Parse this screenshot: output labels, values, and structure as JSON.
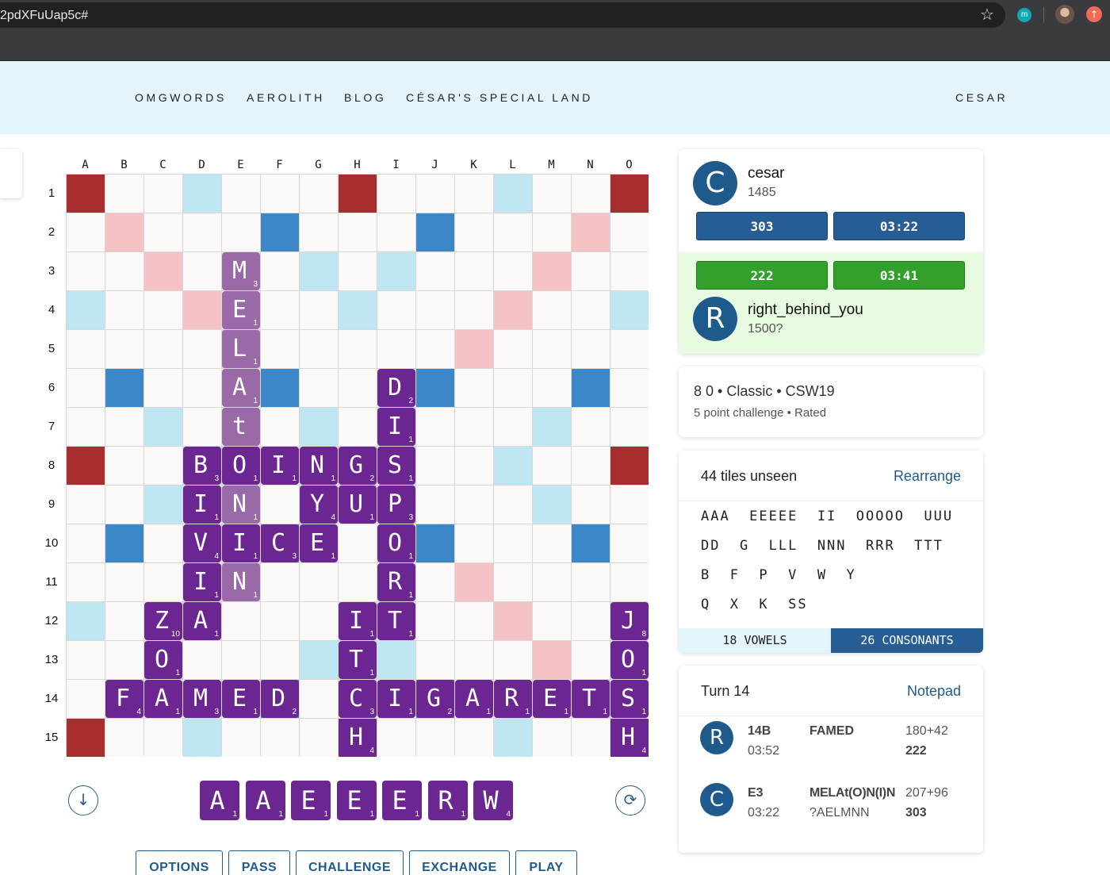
{
  "browser": {
    "url": "2pdXFuUap5c#",
    "icons": [
      "star-icon",
      "extension-m-icon",
      "profile-avatar",
      "update-arrow-icon"
    ],
    "ext_m_label": "m"
  },
  "nav": {
    "items": [
      "OMGWORDS",
      "AEROLITH",
      "BLOG",
      "CÉSAR'S SPECIAL LAND"
    ],
    "user": "CESAR"
  },
  "board": {
    "columns": [
      "A",
      "B",
      "C",
      "D",
      "E",
      "F",
      "G",
      "H",
      "I",
      "J",
      "K",
      "L",
      "M",
      "N",
      "O"
    ],
    "rows": [
      "1",
      "2",
      "3",
      "4",
      "5",
      "6",
      "7",
      "8",
      "9",
      "10",
      "11",
      "12",
      "13",
      "14",
      "15"
    ],
    "premium_legend": {
      "dl": "#bde6f2",
      "tl": "#3d87c9",
      "dw": "#f4c1c4",
      "tw": "#a72e2e"
    },
    "premium": [
      "T..d...T...d..T",
      ".W...t...t...W.",
      "..W...d.d...W..",
      "d..W...d...W..d",
      "....W.....W....",
      ".t...t...t...t.",
      "..d...d.d...d..",
      "T..d...W...d..T",
      "..d...d.d...d..",
      ".t...t...t...t.",
      "....W.....W....",
      "d..W...d...W..d",
      "..W...d.d...W..",
      ".W...t...t...W.",
      "T..d...T...d..T"
    ],
    "tiles": [
      {
        "r": 2,
        "c": 4,
        "l": "M",
        "s": "3",
        "last": true
      },
      {
        "r": 3,
        "c": 4,
        "l": "E",
        "s": "1",
        "last": true
      },
      {
        "r": 4,
        "c": 4,
        "l": "L",
        "s": "1",
        "last": true
      },
      {
        "r": 5,
        "c": 4,
        "l": "A",
        "s": "1",
        "last": true
      },
      {
        "r": 6,
        "c": 4,
        "l": "t",
        "s": "",
        "last": true
      },
      {
        "r": 5,
        "c": 8,
        "l": "D",
        "s": "2"
      },
      {
        "r": 6,
        "c": 8,
        "l": "I",
        "s": "1"
      },
      {
        "r": 7,
        "c": 3,
        "l": "B",
        "s": "3"
      },
      {
        "r": 7,
        "c": 4,
        "l": "O",
        "s": "1"
      },
      {
        "r": 7,
        "c": 5,
        "l": "I",
        "s": "1"
      },
      {
        "r": 7,
        "c": 6,
        "l": "N",
        "s": "1"
      },
      {
        "r": 7,
        "c": 7,
        "l": "G",
        "s": "2"
      },
      {
        "r": 7,
        "c": 8,
        "l": "S",
        "s": "1"
      },
      {
        "r": 8,
        "c": 3,
        "l": "I",
        "s": "1"
      },
      {
        "r": 8,
        "c": 4,
        "l": "N",
        "s": "1",
        "last": true
      },
      {
        "r": 8,
        "c": 6,
        "l": "Y",
        "s": "4"
      },
      {
        "r": 8,
        "c": 7,
        "l": "U",
        "s": "1"
      },
      {
        "r": 8,
        "c": 8,
        "l": "P",
        "s": "3"
      },
      {
        "r": 9,
        "c": 3,
        "l": "V",
        "s": "4"
      },
      {
        "r": 9,
        "c": 4,
        "l": "I",
        "s": "1"
      },
      {
        "r": 9,
        "c": 5,
        "l": "C",
        "s": "3"
      },
      {
        "r": 9,
        "c": 6,
        "l": "E",
        "s": "1"
      },
      {
        "r": 9,
        "c": 8,
        "l": "O",
        "s": "1"
      },
      {
        "r": 10,
        "c": 3,
        "l": "I",
        "s": "1"
      },
      {
        "r": 10,
        "c": 4,
        "l": "N",
        "s": "1",
        "last": true
      },
      {
        "r": 10,
        "c": 8,
        "l": "R",
        "s": "1"
      },
      {
        "r": 11,
        "c": 2,
        "l": "Z",
        "s": "10"
      },
      {
        "r": 11,
        "c": 3,
        "l": "A",
        "s": "1"
      },
      {
        "r": 11,
        "c": 7,
        "l": "I",
        "s": "1"
      },
      {
        "r": 11,
        "c": 8,
        "l": "T",
        "s": "1"
      },
      {
        "r": 11,
        "c": 14,
        "l": "J",
        "s": "8"
      },
      {
        "r": 12,
        "c": 2,
        "l": "O",
        "s": "1"
      },
      {
        "r": 12,
        "c": 7,
        "l": "T",
        "s": "1"
      },
      {
        "r": 12,
        "c": 14,
        "l": "O",
        "s": "1"
      },
      {
        "r": 13,
        "c": 1,
        "l": "F",
        "s": "4"
      },
      {
        "r": 13,
        "c": 2,
        "l": "A",
        "s": "1"
      },
      {
        "r": 13,
        "c": 3,
        "l": "M",
        "s": "3"
      },
      {
        "r": 13,
        "c": 4,
        "l": "E",
        "s": "1"
      },
      {
        "r": 13,
        "c": 5,
        "l": "D",
        "s": "2"
      },
      {
        "r": 13,
        "c": 7,
        "l": "C",
        "s": "3"
      },
      {
        "r": 13,
        "c": 8,
        "l": "I",
        "s": "1"
      },
      {
        "r": 13,
        "c": 9,
        "l": "G",
        "s": "2"
      },
      {
        "r": 13,
        "c": 10,
        "l": "A",
        "s": "1"
      },
      {
        "r": 13,
        "c": 11,
        "l": "R",
        "s": "1"
      },
      {
        "r": 13,
        "c": 12,
        "l": "E",
        "s": "1"
      },
      {
        "r": 13,
        "c": 13,
        "l": "T",
        "s": "1"
      },
      {
        "r": 13,
        "c": 14,
        "l": "S",
        "s": "1"
      },
      {
        "r": 14,
        "c": 7,
        "l": "H",
        "s": "4"
      },
      {
        "r": 14,
        "c": 14,
        "l": "H",
        "s": "4"
      }
    ]
  },
  "rack": [
    {
      "l": "A",
      "s": "1"
    },
    {
      "l": "A",
      "s": "1"
    },
    {
      "l": "E",
      "s": "1"
    },
    {
      "l": "E",
      "s": "1"
    },
    {
      "l": "E",
      "s": "1"
    },
    {
      "l": "R",
      "s": "1"
    },
    {
      "l": "W",
      "s": "4"
    }
  ],
  "rack_controls": {
    "left_icon": "arrow-down-circle-icon",
    "right_icon": "refresh-circle-icon"
  },
  "actions": [
    "OPTIONS",
    "PASS",
    "CHALLENGE",
    "EXCHANGE",
    "PLAY"
  ],
  "players": [
    {
      "initial": "C",
      "name": "cesar",
      "rating": "1485",
      "score": "303",
      "time": "03:22",
      "color": "#275d95"
    },
    {
      "initial": "R",
      "name": "right_behind_you",
      "rating": "1500?",
      "score": "222",
      "time": "03:41",
      "color": "#33a02c",
      "on_turn": true
    }
  ],
  "game_info": {
    "title": "8 0 • Classic • CSW19",
    "subtitle": "5 point challenge • Rated"
  },
  "unseen": {
    "title": "44 tiles unseen",
    "rearrange": "Rearrange",
    "lines": [
      "AAA  EEEEE  II  OOOOO  UUU",
      "DD  G  LLL  NNN  RRR  TTT",
      "B  F  P  V  W  Y",
      "Q  X  K  SS"
    ],
    "vowels": "18 VOWELS",
    "consonants": "26 CONSONANTS"
  },
  "turn": {
    "title": "Turn 14",
    "notepad": "Notepad",
    "moves": [
      {
        "initial": "R",
        "coord": "14B",
        "time": "03:52",
        "word": "FAMED",
        "rack": "",
        "score": "180+42",
        "total": "222"
      },
      {
        "initial": "C",
        "coord": "E3",
        "time": "03:22",
        "word": "MELAt(O)N(I)N",
        "rack": "?AELMNN",
        "score": "207+96",
        "total": "303"
      }
    ]
  }
}
